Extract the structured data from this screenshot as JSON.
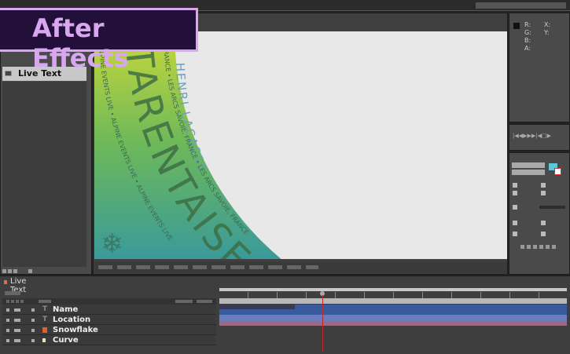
{
  "title_banner": "After Effects",
  "project_panel": {
    "item_label": "Live Text"
  },
  "info_panel": {
    "labels": [
      "R:",
      "G:",
      "B:",
      "A:"
    ],
    "coords": [
      "X:",
      "Y:"
    ]
  },
  "artwork": {
    "big_text": "TARENTAISE",
    "name_text": "HENRI LACASSE",
    "inner_arc_text": "FRANCE • LES ARCS SAVOIE, FRANCE • LES ARCS SAVOIE, FRANCE",
    "outer_arc_text": "ALPINE EVENTS LIVE • ALPINE EVENTS LIVE • ALPINE EVENTS LIVE",
    "snowflake": "❄"
  },
  "colors": {
    "accent": "#d9a6f0",
    "banner_bg": "#220f3a",
    "playhead": "#c0262a",
    "fill_swatch": "#5fc8d8"
  },
  "timeline": {
    "tab_label": "Live Text",
    "layers": [
      {
        "name": "Name",
        "icon": "text-icon"
      },
      {
        "name": "Location",
        "icon": "text-icon"
      },
      {
        "name": "Snowflake",
        "icon": "shape-icon"
      },
      {
        "name": "Curve",
        "icon": "solid-icon"
      }
    ],
    "playhead_fraction": 0.3
  }
}
